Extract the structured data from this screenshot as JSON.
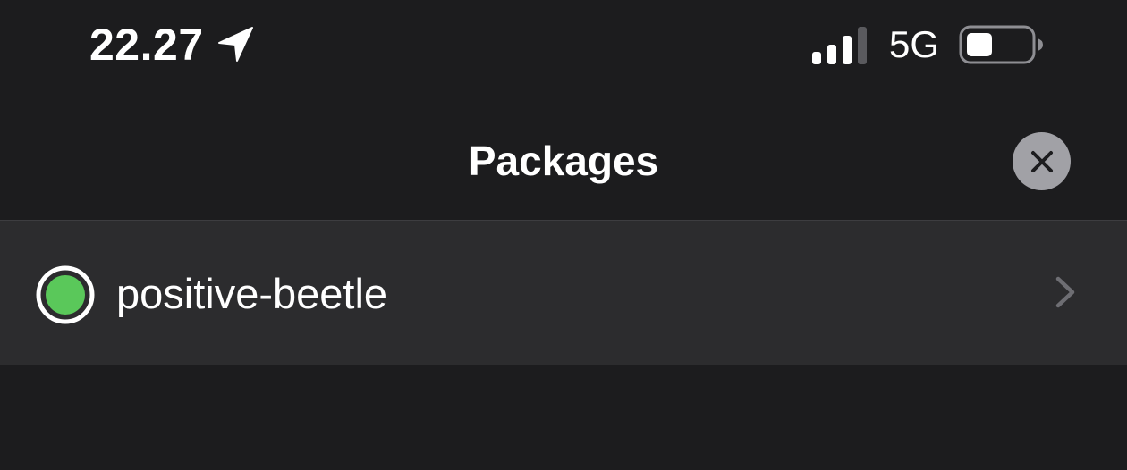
{
  "status_bar": {
    "time": "22.27",
    "network": "5G",
    "icons": {
      "location": "location-arrow-icon",
      "signal": "cellular-signal-icon",
      "battery": "battery-icon"
    },
    "signal_bars_filled": 3,
    "signal_bars_total": 4,
    "battery_level": 0.3
  },
  "nav": {
    "title": "Packages",
    "close_icon": "close-icon"
  },
  "list": {
    "items": [
      {
        "label": "positive-beetle",
        "status_color": "#5ac85a",
        "status_icon": "status-dot-icon",
        "accessory_icon": "chevron-right-icon"
      }
    ]
  },
  "colors": {
    "background": "#1c1c1e",
    "row_background": "#2c2c2e",
    "close_button": "#a1a1a6",
    "status_green": "#5ac85a"
  }
}
